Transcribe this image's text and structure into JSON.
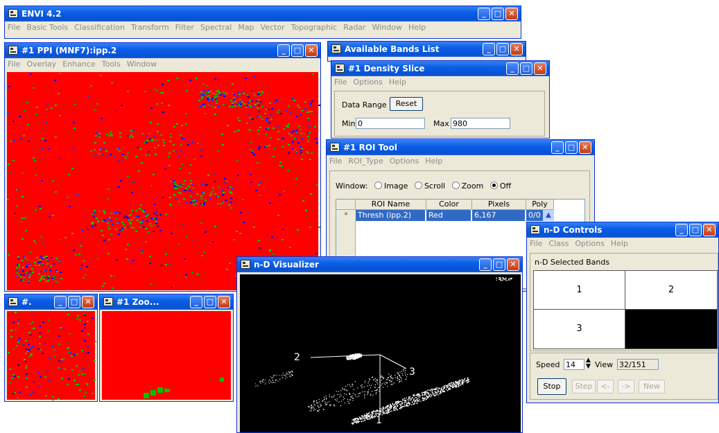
{
  "envi": {
    "title": "ENVI 4.2",
    "menu": [
      "File",
      "Basic Tools",
      "Classification",
      "Transform",
      "Filter",
      "Spectral",
      "Map",
      "Vector",
      "Topographic",
      "Radar",
      "Window",
      "Help"
    ]
  },
  "ppi": {
    "title": "#1 PPI (MNF7):ipp.2",
    "menu": [
      "File",
      "Overlay",
      "Enhance",
      "Tools",
      "Window"
    ],
    "image_color": "#ff0000"
  },
  "small1": {
    "title": "#."
  },
  "small2": {
    "title": "#1 Zoo..."
  },
  "bands": {
    "title": "Available Bands List"
  },
  "density": {
    "title": "#1 Density Slice",
    "menu": [
      "File",
      "Options",
      "Help"
    ],
    "data_range_label": "Data Range",
    "reset_label": "Reset",
    "min_label": "Min",
    "min_value": "0",
    "max_label": "Max",
    "max_value": "980"
  },
  "roi": {
    "title": "#1 ROI Tool",
    "menu": [
      "File",
      "ROI_Type",
      "Options",
      "Help"
    ],
    "window_label": "Window:",
    "radios": [
      {
        "label": "Image",
        "checked": false
      },
      {
        "label": "Scroll",
        "checked": false
      },
      {
        "label": "Zoom",
        "checked": false
      },
      {
        "label": "Off",
        "checked": true
      }
    ],
    "columns": [
      "ROI Name",
      "Color",
      "Pixels",
      "Poly"
    ],
    "rows": [
      {
        "marker": "*",
        "name": "Thresh (ipp.2)",
        "color": "Red",
        "pixels": "6,167",
        "poly": "0/0"
      }
    ]
  },
  "ndviz": {
    "title": "n-D Visualizer",
    "axis_labels": [
      "2",
      "3",
      "1"
    ]
  },
  "ndc": {
    "title": "n-D Controls",
    "menu": [
      "File",
      "Class",
      "Options",
      "Help"
    ],
    "selected_bands_label": "n-D Selected Bands",
    "bands": [
      "1",
      "2",
      "3",
      ""
    ],
    "speed_label": "Speed",
    "speed_value": "14",
    "view_label": "View",
    "view_value": "32/151",
    "buttons": [
      "Stop",
      "Step",
      "<-",
      "->",
      "New"
    ]
  },
  "colors": {
    "titlebar": "#0a5fe8",
    "raster_red": "#ff0000",
    "selection": "#316ac5"
  }
}
